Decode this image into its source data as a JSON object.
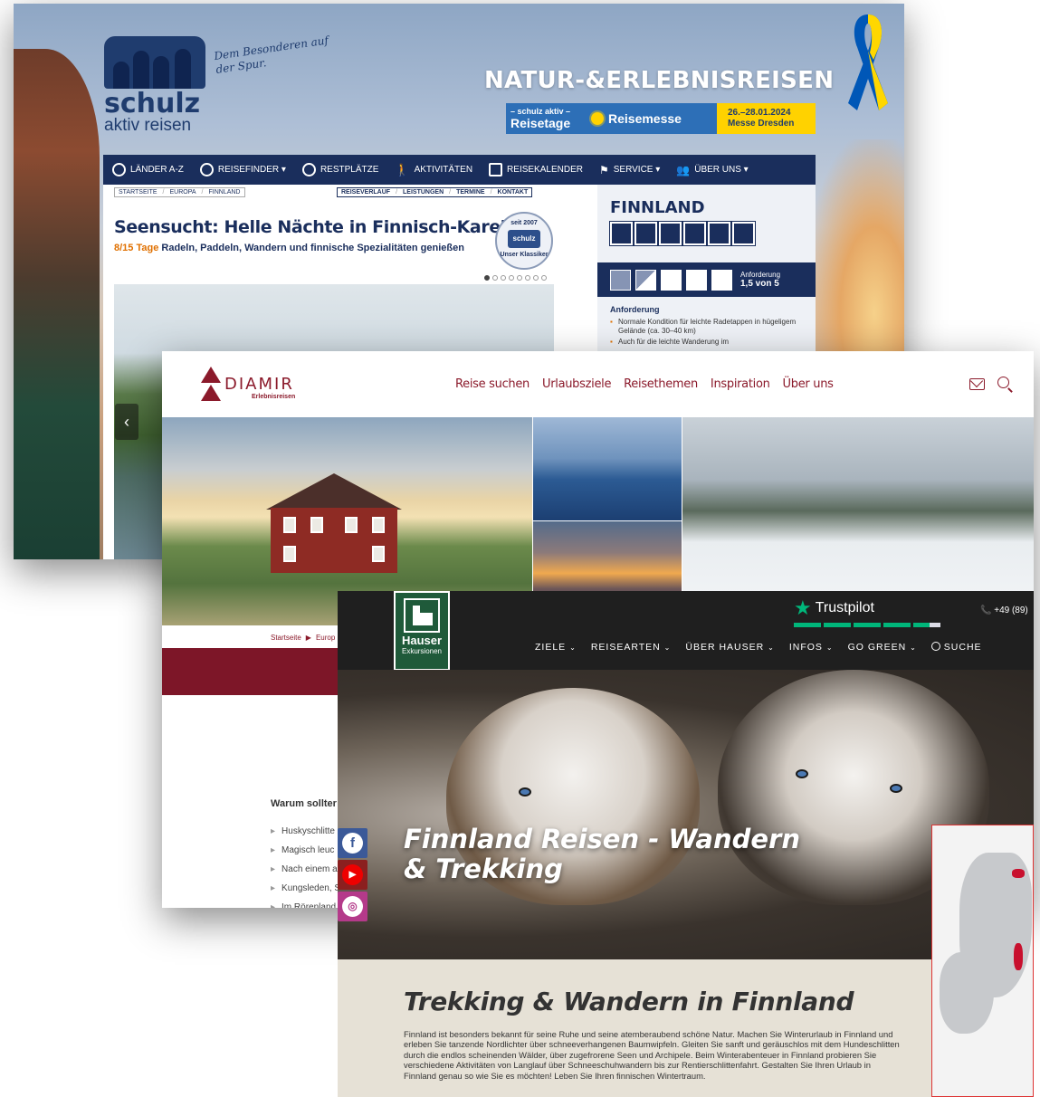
{
  "schulz": {
    "logo_name": "schulz",
    "logo_sub": "aktiv reisen",
    "motto": "Dem Besonderen auf der Spur.",
    "headline": "NATUR-&ERLEBNISREISEN",
    "ribbon_text": "#StandWithUkraine",
    "banner": {
      "small": "– schulz aktiv –",
      "reisetage": "Reisetage",
      "reisemesse": "Reisemesse",
      "date": "26.–28.01.2024",
      "place": "Messe Dresden"
    },
    "nav": [
      "LÄNDER A-Z",
      "REISEFINDER ▾",
      "RESTPLÄTZE",
      "AKTIVITÄTEN",
      "REISEKALENDER",
      "SERVICE ▾",
      "ÜBER UNS ▾"
    ],
    "breadcrumb": [
      "STARTSEITE",
      "EUROPA",
      "FINNLAND"
    ],
    "subtabs": [
      "REISEVERLAUF",
      "LEISTUNGEN",
      "TERMINE",
      "KONTAKT"
    ],
    "title": "Seensucht: Helle Nächte in Finnisch-Karelien",
    "subtitle_days": "8/15 Tage",
    "subtitle_text": "Radeln, Paddeln, Wandern und finnische Spezialitäten genießen",
    "badge_top": "seit 2007",
    "badge_mid": "schulz",
    "badge_bottom": "Unser Klassiker",
    "slider_dots": 8,
    "slider_active": 1,
    "side_title": "FINNLAND",
    "activity_icons": [
      "house-icon",
      "cabin-icon",
      "hiking-icon",
      "canoe-icon",
      "bike-icon",
      "group-icon"
    ],
    "difficulty_label": "Anforderung",
    "difficulty_value": "1,5 von 5",
    "difficulty_level": 1.5,
    "difficulty_max": 5,
    "req_heading": "Anforderung",
    "req_items": [
      "Normale Kondition für leichte Radetappen in hügeligem Gelände (ca. 30–40 km)",
      "Auch für die leichte Wanderung im"
    ],
    "prev_arrow": "‹"
  },
  "diamir": {
    "logo_name": "DIAMIR",
    "logo_sub": "Erlebnisreisen",
    "nav": [
      "Reise suchen",
      "Urlaubsziele",
      "Reisethemen",
      "Inspiration",
      "Über uns"
    ],
    "breadcrumb": [
      "Startseite",
      "Europ"
    ],
    "why_heading": "Warum sollter",
    "list": [
      "Huskyschlitte",
      "Magisch leuc",
      "Nach einem a",
      "Kungsleden, S",
      "Im Rörenland"
    ]
  },
  "hauser": {
    "logo_name": "Hauser",
    "logo_sub": "Exkursionen",
    "trustpilot": "Trustpilot",
    "trustpilot_rating": 4.6,
    "phone": "+49 (89)",
    "nav": [
      "ZIELE",
      "REISEARTEN",
      "ÜBER HAUSER",
      "INFOS",
      "GO GREEN"
    ],
    "search_label": "SUCHE",
    "hero_title": "Finnland Reisen - Wandern & Trekking",
    "social": [
      "f",
      "▶",
      "◎"
    ],
    "h2": "Trekking & Wandern in Finnland",
    "body": "Finnland ist besonders bekannt für seine Ruhe und seine atemberaubend schöne Natur. Machen Sie Winterurlaub in Finnland und erleben Sie tanzende Nordlichter über schneeverhangenen Baumwipfeln. Gleiten Sie sanft und geräuschlos mit dem Hundeschlitten durch die endlos scheinenden Wälder, über zugefrorene Seen und Archipele. Beim Winterabenteuer in Finnland probieren Sie verschiedene Aktivitäten von Langlauf über Schneeschuhwandern bis zur Rentierschlittenfahrt. Gestalten Sie Ihren Urlaub in Finnland genau so wie Sie es möchten! Leben Sie Ihren finnischen Wintertraum."
  },
  "colors": {
    "schulz_navy": "#1a2e5c",
    "schulz_orange": "#e07000",
    "diamir_red": "#8b1a2b",
    "hauser_green": "#1f5a3a",
    "trustpilot_green": "#00b67a"
  }
}
